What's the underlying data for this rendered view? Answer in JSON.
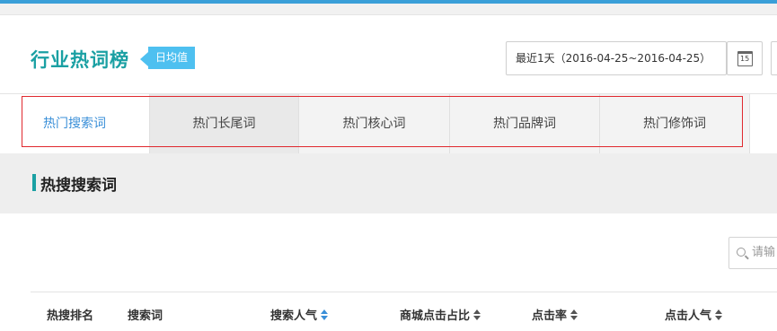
{
  "header": {
    "title": "行业热词榜",
    "badge": "日均值",
    "date_range": "最近1天（2016-04-25~2016-04-25）",
    "calendar_day": "15"
  },
  "tabs": [
    {
      "label": "热门搜索词",
      "active": true
    },
    {
      "label": "热门长尾词",
      "active": false
    },
    {
      "label": "热门核心词",
      "active": false
    },
    {
      "label": "热门品牌词",
      "active": false
    },
    {
      "label": "热门修饰词",
      "active": false
    }
  ],
  "section": {
    "title": "热搜搜索词"
  },
  "search": {
    "placeholder": "请输"
  },
  "table": {
    "columns": [
      {
        "label": "热搜排名",
        "sortable": false
      },
      {
        "label": "搜索词",
        "sortable": false
      },
      {
        "label": "搜索人气",
        "sortable": true,
        "active_sort": true
      },
      {
        "label": "商城点击占比",
        "sortable": true
      },
      {
        "label": "点击率",
        "sortable": true
      },
      {
        "label": "点击人气",
        "sortable": true
      }
    ]
  },
  "colors": {
    "brand": "#1aa0a3",
    "badge": "#4ec0f0",
    "active_tab_text": "#3a8fd8",
    "highlight_outline": "#e0282e"
  },
  "icons": {
    "calendar": "calendar-icon",
    "search": "search-icon",
    "sort": "sort-icon"
  }
}
